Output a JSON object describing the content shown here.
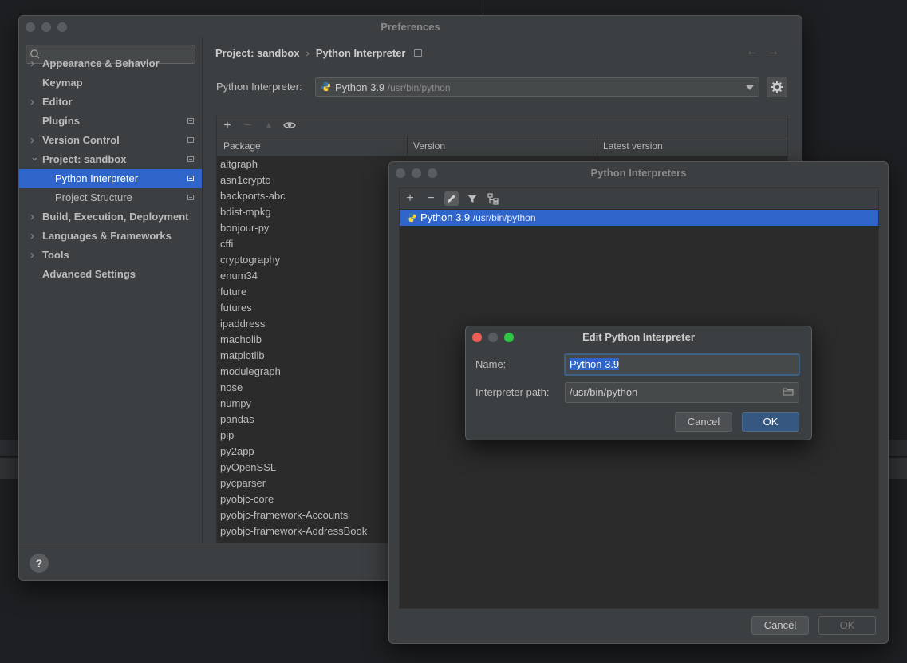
{
  "preferences": {
    "title": "Preferences",
    "search_placeholder": "",
    "nav": [
      {
        "label": "Appearance & Behavior",
        "expandable": true,
        "bold": true
      },
      {
        "label": "Keymap",
        "expandable": false,
        "bold": true
      },
      {
        "label": "Editor",
        "expandable": true,
        "bold": true
      },
      {
        "label": "Plugins",
        "expandable": false,
        "bold": true
      },
      {
        "label": "Version Control",
        "expandable": true,
        "bold": true
      },
      {
        "label": "Project: sandbox",
        "expandable": true,
        "expanded": true,
        "bold": true
      },
      {
        "label": "Python Interpreter",
        "selected": true
      },
      {
        "label": "Project Structure"
      },
      {
        "label": "Build, Execution, Deployment",
        "expandable": true,
        "bold": true
      },
      {
        "label": "Languages & Frameworks",
        "expandable": true,
        "bold": true
      },
      {
        "label": "Tools",
        "expandable": true,
        "bold": true
      },
      {
        "label": "Advanced Settings",
        "expandable": false,
        "bold": true
      }
    ],
    "breadcrumb": {
      "project": "Project: sandbox",
      "page": "Python Interpreter"
    },
    "interpreter_label": "Python Interpreter:",
    "interpreter_selected": {
      "name": "Python 3.9",
      "path": "/usr/bin/python"
    },
    "table": {
      "columns": [
        "Package",
        "Version",
        "Latest version"
      ],
      "packages": [
        "altgraph",
        "asn1crypto",
        "backports-abc",
        "bdist-mpkg",
        "bonjour-py",
        "cffi",
        "cryptography",
        "enum34",
        "future",
        "futures",
        "ipaddress",
        "macholib",
        "matplotlib",
        "modulegraph",
        "nose",
        "numpy",
        "pandas",
        "pip",
        "py2app",
        "pyOpenSSL",
        "pycparser",
        "pyobjc-core",
        "pyobjc-framework-Accounts",
        "pyobjc-framework-AddressBook"
      ]
    },
    "help_label": "?"
  },
  "interpreters_dialog": {
    "title": "Python Interpreters",
    "items": [
      {
        "name": "Python 3.9",
        "path": "/usr/bin/python"
      }
    ],
    "cancel_label": "Cancel",
    "ok_label": "OK"
  },
  "edit_dialog": {
    "title": "Edit Python Interpreter",
    "name_label": "Name:",
    "name_value": "Python 3.9",
    "path_label": "Interpreter path:",
    "path_value": "/usr/bin/python",
    "cancel_label": "Cancel",
    "ok_label": "OK"
  },
  "colors": {
    "accent": "#2f65ca",
    "primary_button": "#365880",
    "window_bg": "#3c3f41",
    "list_bg": "#2b2b2b"
  }
}
